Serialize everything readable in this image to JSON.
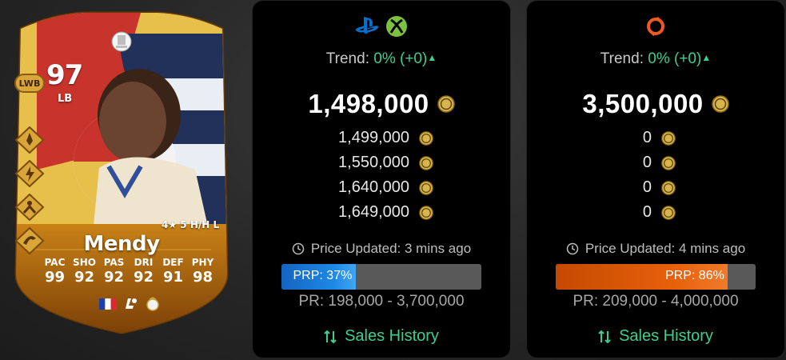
{
  "player": {
    "rating": "97",
    "position_badge": "LWB",
    "alt_position": "LB",
    "skills_text": "4★ 5 H/H L",
    "name": "Mendy",
    "stats": [
      {
        "label": "PAC",
        "value": "99"
      },
      {
        "label": "SHO",
        "value": "92"
      },
      {
        "label": "PAS",
        "value": "92"
      },
      {
        "label": "DRI",
        "value": "92"
      },
      {
        "label": "DEF",
        "value": "91"
      },
      {
        "label": "PHY",
        "value": "98"
      }
    ],
    "playstyle_icons": [
      "rocket-icon",
      "lightning-shield-icon",
      "intercept-icon",
      "boomerang-icon"
    ],
    "league_badge_text": "LALIGA"
  },
  "console_panel": {
    "platform_icons": [
      "playstation-icon",
      "xbox-icon"
    ],
    "trend_label": "Trend:",
    "trend_value": "0% (+0)",
    "main_price": "1,498,000",
    "prices": [
      "1,499,000",
      "1,550,000",
      "1,640,000",
      "1,649,000"
    ],
    "updated_text": "Price Updated: 3 mins ago",
    "prp_label": "PRP: 37%",
    "prp_percent": 37,
    "pr_range": "PR: 198,000 - 3,700,000",
    "sales_label": "Sales History"
  },
  "pc_panel": {
    "platform_icons": [
      "origin-icon"
    ],
    "trend_label": "Trend:",
    "trend_value": "0% (+0)",
    "main_price": "3,500,000",
    "prices": [
      "0",
      "0",
      "0",
      "0"
    ],
    "updated_text": "Price Updated: 4 mins ago",
    "prp_label": "PRP: 86%",
    "prp_percent": 86,
    "pr_range": "PR: 209,000 - 4,000,000",
    "sales_label": "Sales History"
  },
  "colors": {
    "trend_green": "#3ccf8e",
    "prp_blue": "#1e88e5",
    "prp_orange": "#e8610c",
    "card_gold": "#d9a63a"
  }
}
